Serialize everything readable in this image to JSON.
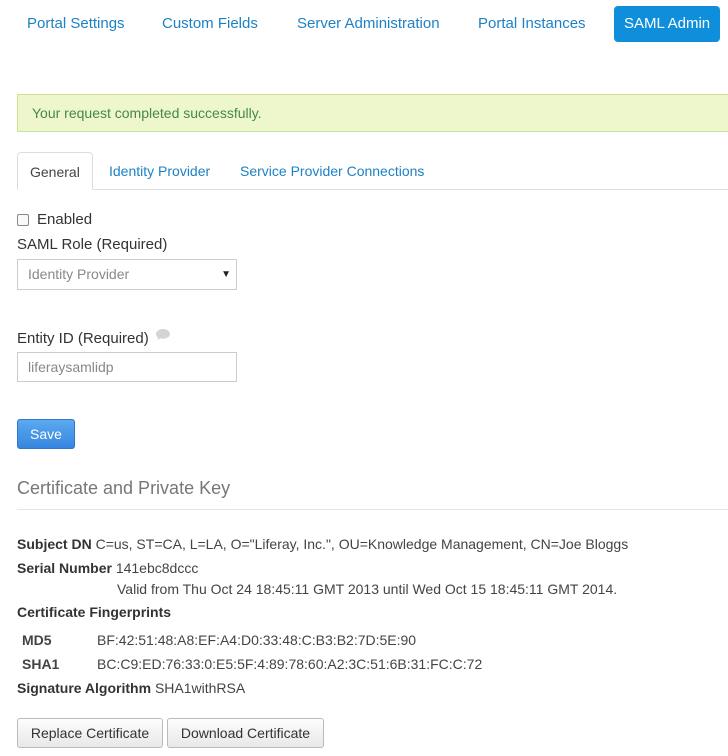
{
  "nav": {
    "items": [
      "Portal Settings",
      "Custom Fields",
      "Server Administration",
      "Portal Instances"
    ],
    "active": "SAML Admin"
  },
  "alert": "Your request completed successfully.",
  "tabs": [
    "General",
    "Identity Provider",
    "Service Provider Connections"
  ],
  "general": {
    "enabled_label": "Enabled",
    "role_label": "SAML Role (Required)",
    "role_value": "Identity Provider",
    "entity_label": "Entity ID (Required)",
    "entity_value": "liferaysamlidp",
    "save": "Save"
  },
  "certificate": {
    "title": "Certificate and Private Key",
    "subject_label": "Subject DN",
    "subject_value": "C=us, ST=CA, L=LA, O=\"Liferay, Inc.\", OU=Knowledge Management, CN=Joe Bloggs",
    "serial_label": "Serial Number",
    "serial_value": "141ebc8dccc",
    "validity": "Valid from Thu Oct 24 18:45:11 GMT 2013 until Wed Oct 15 18:45:11 GMT 2014.",
    "fingerprints_label": "Certificate Fingerprints",
    "md5_label": "MD5",
    "md5_value": "BF:42:51:48:A8:EF:A4:D0:33:48:C:B3:B2:7D:5E:90",
    "sha1_label": "SHA1",
    "sha1_value": "BC:C9:ED:76:33:0:E5:5F:4:89:78:60:A2:3C:51:6B:31:FC:C:72",
    "algorithm_label": "Signature Algorithm",
    "algorithm_value": "SHA1withRSA",
    "replace": "Replace Certificate",
    "download": "Download Certificate"
  },
  "icons": {
    "help": "speech-bubble-icon",
    "select": "caret-down-icon"
  }
}
